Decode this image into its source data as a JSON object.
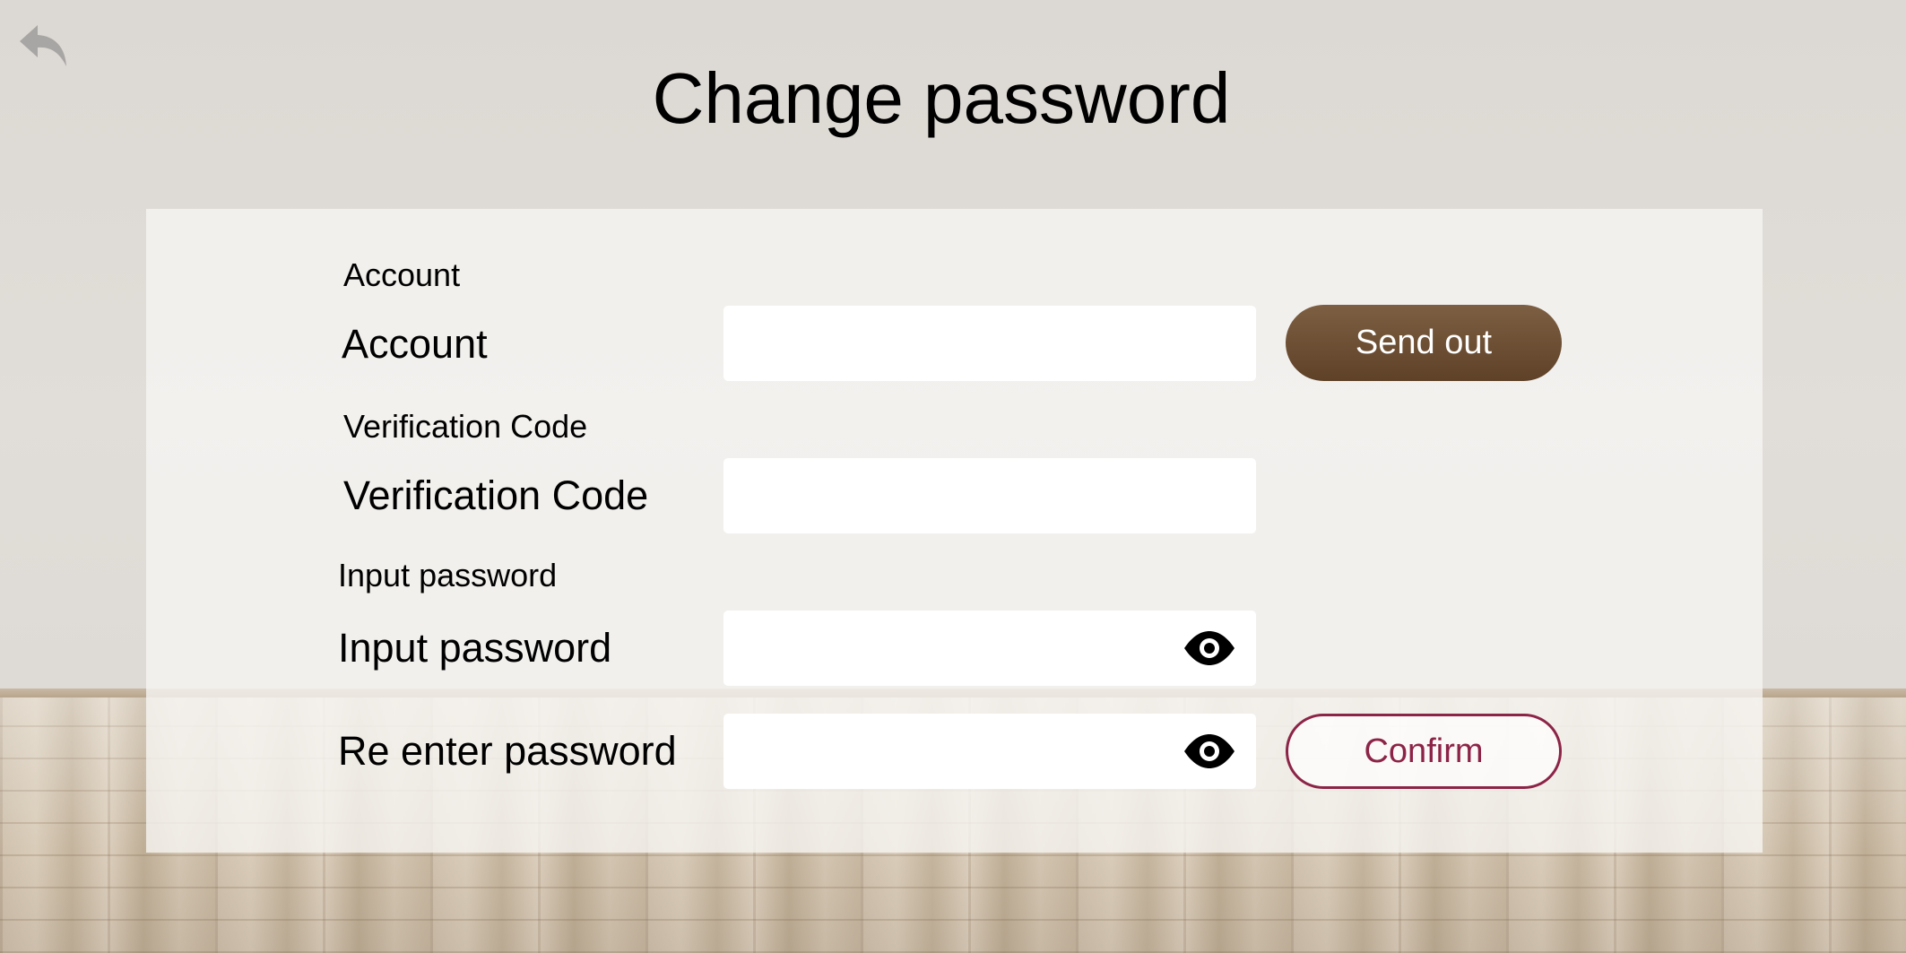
{
  "page": {
    "title": "Change password"
  },
  "form": {
    "account": {
      "caption": "Account",
      "label": "Account",
      "value": "",
      "placeholder": ""
    },
    "verification_code": {
      "caption": "Verification Code",
      "label": "Verification Code",
      "value": "",
      "placeholder": ""
    },
    "input_password": {
      "caption": "Input password",
      "label": "Input password",
      "value": "",
      "placeholder": ""
    },
    "reenter_password": {
      "label": "Re enter password",
      "value": "",
      "placeholder": ""
    }
  },
  "buttons": {
    "send_out": "Send out",
    "confirm": "Confirm"
  },
  "icons": {
    "back": "back-arrow-icon",
    "eye": "eye-icon"
  },
  "colors": {
    "send_button": "#6b4e33",
    "confirm_accent": "#8c2447",
    "panel": "#f4f3f1"
  }
}
